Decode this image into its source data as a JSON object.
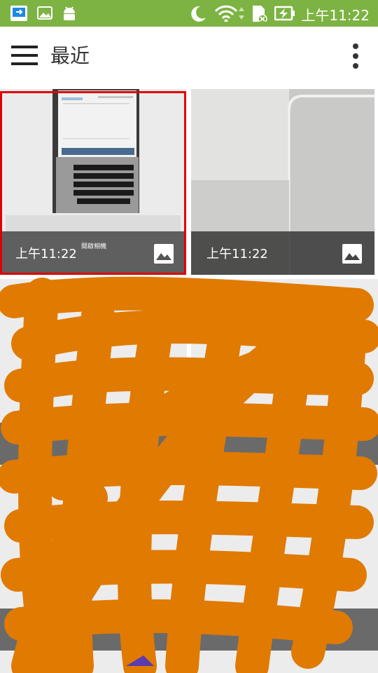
{
  "status_bar": {
    "time": "上午11:22",
    "icons": [
      "remote-icon",
      "gallery-icon",
      "android-icon",
      "moon-icon",
      "wifi-icon",
      "sdcard-icon",
      "battery-charging-icon"
    ],
    "background": "#7cb342"
  },
  "app_bar": {
    "title": "最近",
    "menu_icon": "hamburger-menu-icon",
    "more_icon": "more-vert-icon"
  },
  "grid": {
    "items": [
      {
        "time": "上午11:22",
        "caption": "開啟相機",
        "type_icon": "image-icon",
        "selected": true
      },
      {
        "time": "上午11:22",
        "caption": "",
        "type_icon": "image-icon",
        "selected": false
      }
    ]
  },
  "annotation": {
    "highlight_color": "#e00000",
    "scribble_color": "#e07a00"
  }
}
